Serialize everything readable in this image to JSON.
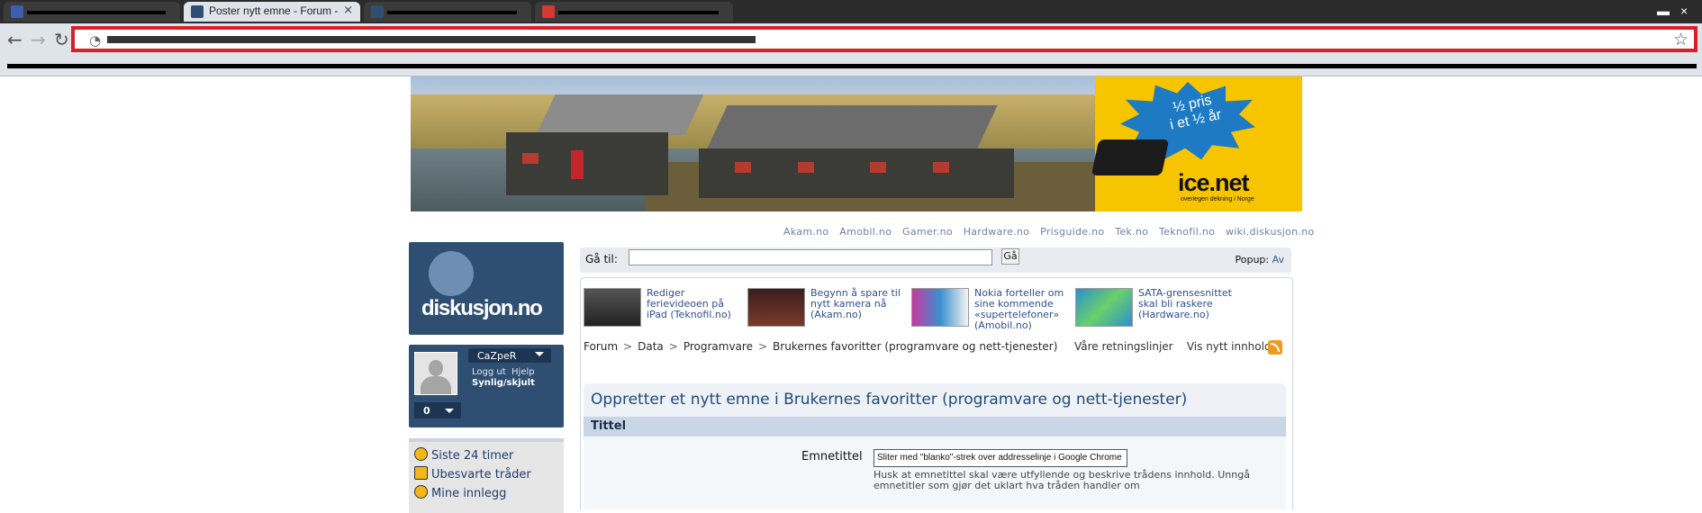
{
  "browser": {
    "active_tab_title": "Poster nytt emne - Forum -",
    "tab_close": "×",
    "win_minimize": "▬",
    "win_close": "×",
    "nav_back": "←",
    "nav_forward": "→",
    "nav_reload": "↻",
    "star": "☆",
    "globe": "◔"
  },
  "ad": {
    "pris_line1": "½ pris",
    "pris_line2": "i et ½ år",
    "brand": "ice.net",
    "slogan": "overlegen dekning i Norge"
  },
  "toplinks": [
    "Akam.no",
    "Amobil.no",
    "Gamer.no",
    "Hardware.no",
    "Prisguide.no",
    "Tek.no",
    "Teknofil.no",
    "wiki.diskusjon.no"
  ],
  "logo": {
    "text": "diskusjon.no"
  },
  "user": {
    "name": "CaZpeR",
    "logout": "Logg ut",
    "help": "Hjelp",
    "visibility": "Synlig/skjult",
    "count": "0"
  },
  "menu": [
    "Siste 24 timer",
    "Ubesvarte tråder",
    "Mine innlegg"
  ],
  "goto": {
    "label": "Gå til:",
    "button": "Gå",
    "popup_label": "Popup:",
    "popup_value": "Av"
  },
  "news": [
    {
      "text": "Rediger ferievideoen på iPad (Teknofil.no)"
    },
    {
      "text": "Begynn å spare til nytt kamera nå (Akam.no)"
    },
    {
      "text": "Nokia forteller om sine kommende «supertelefoner» (Amobil.no)"
    },
    {
      "text": "SATA-grensesnittet skal bli raskere (Hardware.no)"
    }
  ],
  "breadcrumb": [
    "Forum",
    "Data",
    "Programvare",
    "Brukernes favoritter (programvare og nett-tjenester)"
  ],
  "breadcrumb_sep": ">",
  "rules_link": "Våre retningslinjer",
  "new_content_link": "Vis nytt innhold",
  "form": {
    "heading": "Oppretter et nytt emne i Brukernes favoritter (programvare og nett-tjenester)",
    "section": "Tittel",
    "field_label": "Emnetittel",
    "field_value": "Sliter med \"blanko\"-strek over addresselinje i Google Chrome",
    "help_text": "Husk at emnetittel skal være utfyllende og beskrive trådens innhold. Unngå emnetitler som gjør det uklart hva tråden handler om"
  }
}
